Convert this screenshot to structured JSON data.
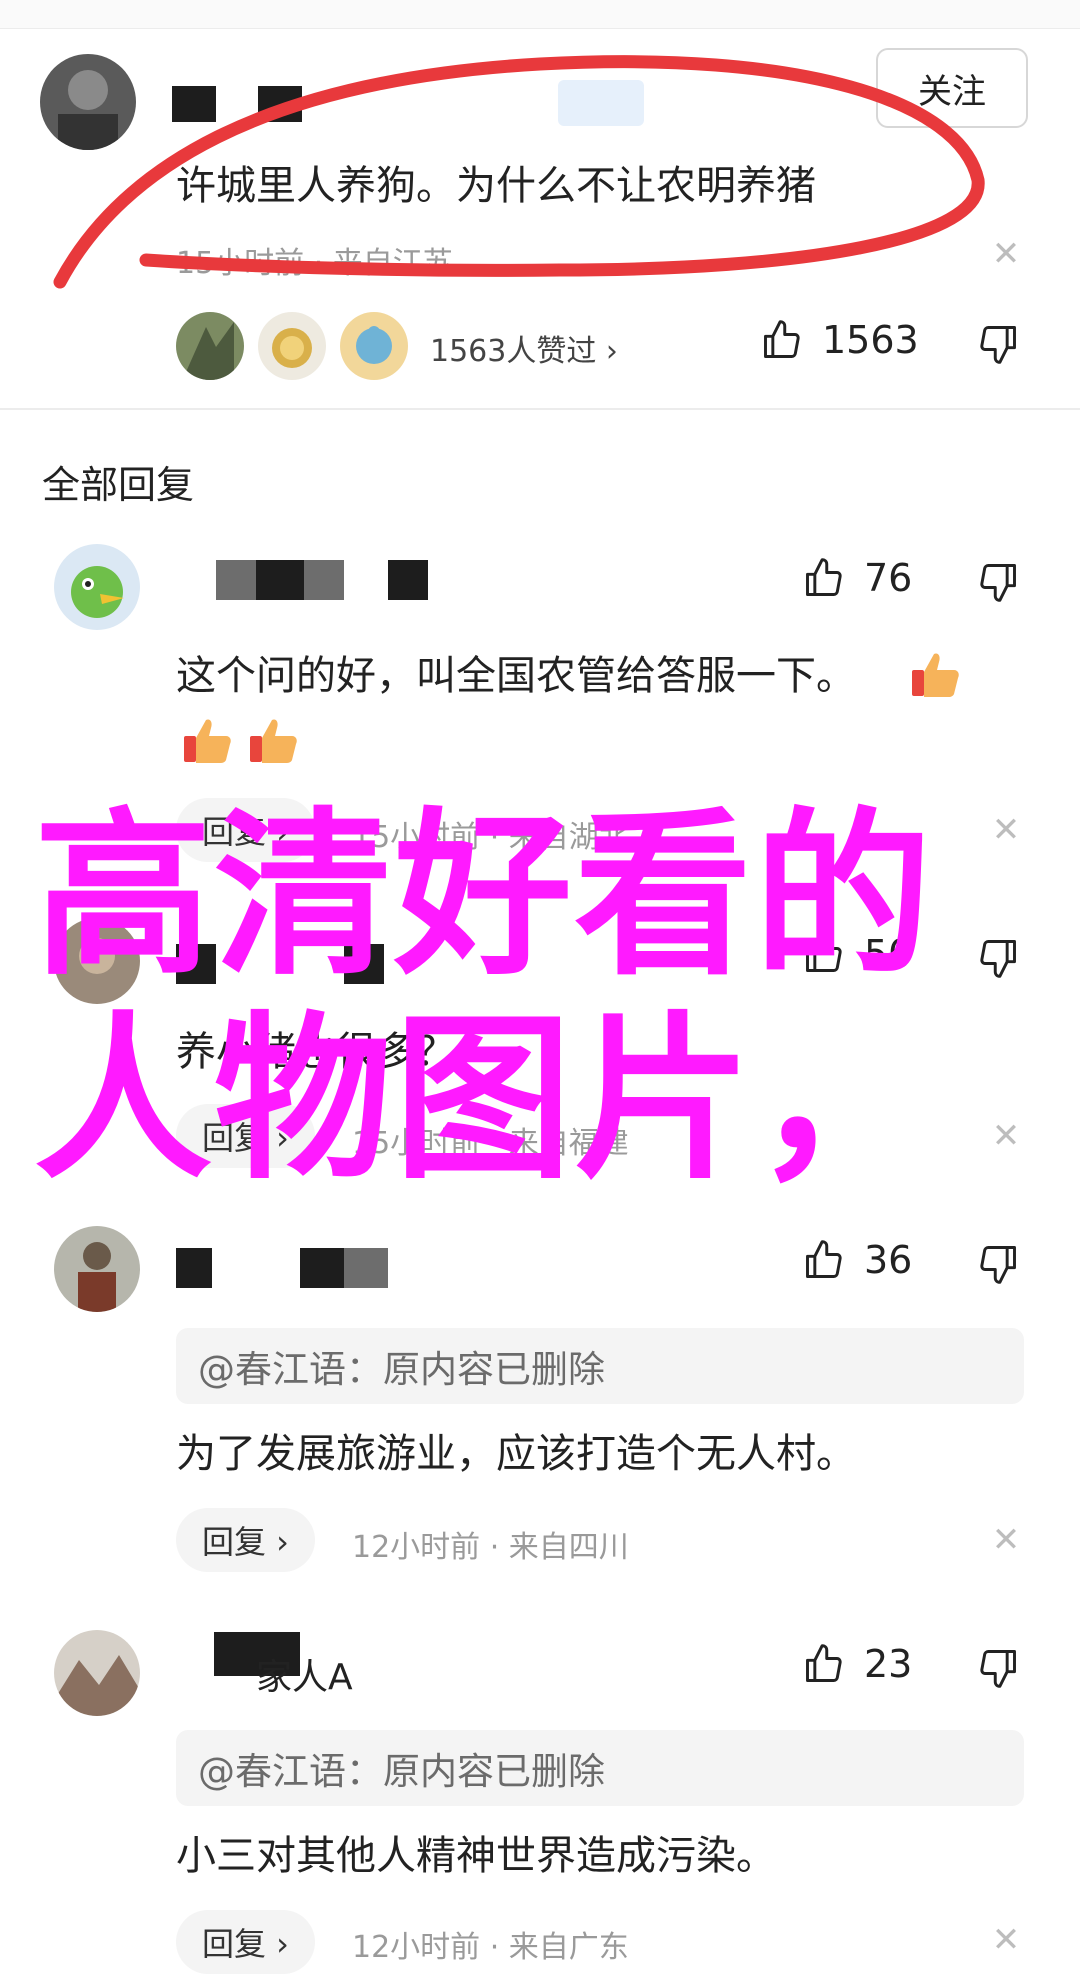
{
  "top_comment": {
    "follow_label": "关注",
    "text": "许城里人养狗。为什么不让农明养猪",
    "meta": "15小时前 · 来自江苏",
    "likers_text": "1563人赞过 ›",
    "like_count": "1563"
  },
  "section_title": "全部回复",
  "replies": [
    {
      "like_count": "76",
      "text": "这个问的好，叫全国农管给答服一下。",
      "reply_label": "回复 ›",
      "meta": "15小时前 · 来自湖北"
    },
    {
      "like_count": "50",
      "text": "养小猪也很多？",
      "reply_label": "回复 ›",
      "meta": "15小时前 · 来自福建"
    },
    {
      "like_count": "36",
      "quote": "@春江语：原内容已删除",
      "text": "为了发展旅游业，应该打造个无人村。",
      "reply_label": "回复 ›",
      "meta": "12小时前 · 来自四川"
    },
    {
      "name_tail": "家人A",
      "like_count": "23",
      "quote": "@春江语：原内容已删除",
      "text": "小三对其他人精神世界造成污染。",
      "reply_label": "回复 ›",
      "meta": "12小时前 · 来自广东"
    }
  ],
  "overlay": {
    "line1": "高清好看的",
    "line2": "人物图片，",
    "color": "#ff1aff"
  },
  "colors": {
    "annotation_red": "#e8393c"
  }
}
